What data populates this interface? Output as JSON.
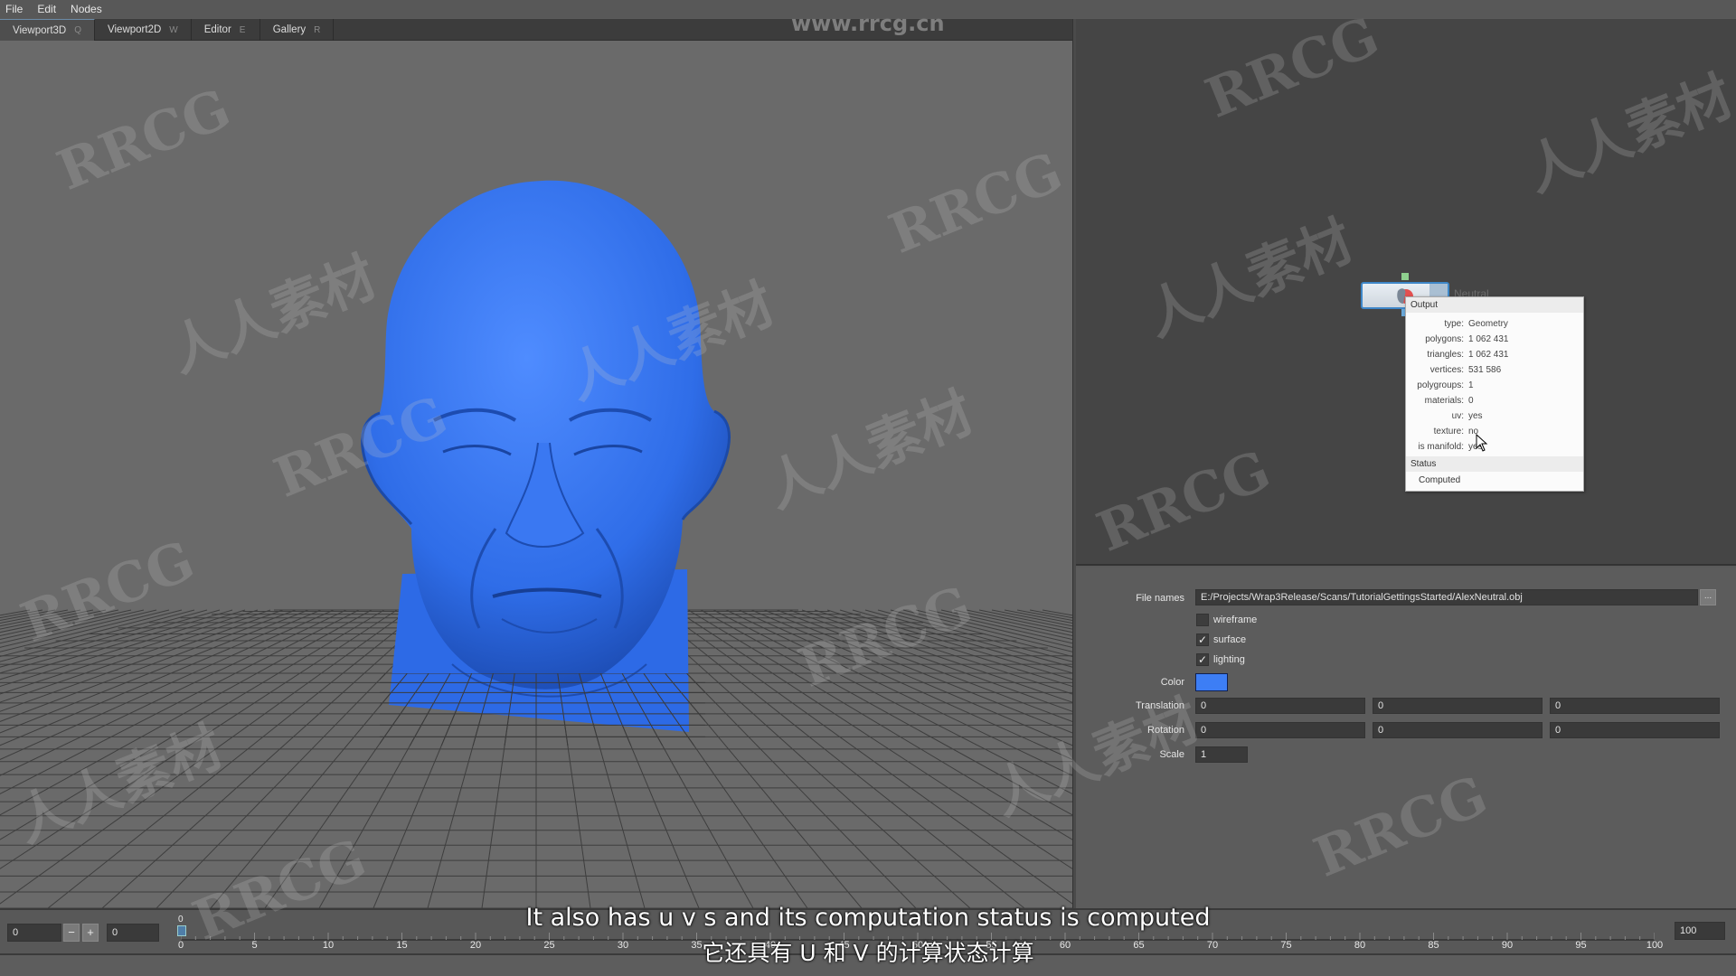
{
  "menubar": {
    "items": [
      "File",
      "Edit",
      "Nodes"
    ]
  },
  "tabs": [
    {
      "label": "Viewport3D",
      "key": "Q",
      "active": true
    },
    {
      "label": "Viewport2D",
      "key": "W",
      "active": false
    },
    {
      "label": "Editor",
      "key": "E",
      "active": false
    },
    {
      "label": "Gallery",
      "key": "R",
      "active": false
    }
  ],
  "watermark": {
    "url": "www.rrcg.cn",
    "brand": "RRCG",
    "cn": "人人素材"
  },
  "node": {
    "label": "Neutral",
    "popup": {
      "output_header": "Output",
      "rows": [
        {
          "key": "type:",
          "value": "Geometry"
        },
        {
          "key": "polygons:",
          "value": "1 062 431"
        },
        {
          "key": "triangles:",
          "value": "1 062 431"
        },
        {
          "key": "vertices:",
          "value": "531 586"
        },
        {
          "key": "polygroups:",
          "value": "1"
        },
        {
          "key": "materials:",
          "value": "0"
        },
        {
          "key": "uv:",
          "value": "yes"
        },
        {
          "key": "texture:",
          "value": "no"
        },
        {
          "key": "is manifold:",
          "value": "yes"
        }
      ],
      "status_header": "Status",
      "status_value": "Computed"
    }
  },
  "properties": {
    "file_names_label": "File names",
    "file_names_value": "E:/Projects/Wrap3Release/Scans/TutorialGettingsStarted/AlexNeutral.obj",
    "browse_label": "...",
    "wireframe": {
      "label": "wireframe",
      "checked": false
    },
    "surface": {
      "label": "surface",
      "checked": true
    },
    "lighting": {
      "label": "lighting",
      "checked": true
    },
    "color_label": "Color",
    "color_value": "#3d7ef5",
    "translation_label": "Translation",
    "translation": [
      "0",
      "0",
      "0"
    ],
    "rotation_label": "Rotation",
    "rotation": [
      "0",
      "0",
      "0"
    ],
    "scale_label": "Scale",
    "scale": "1"
  },
  "timeline": {
    "start": "0",
    "minus": "−",
    "plus": "+",
    "current": "0",
    "cursor_label": "0",
    "end": "100",
    "ticks": [
      "0",
      "5",
      "10",
      "15",
      "20",
      "25",
      "30",
      "35",
      "40",
      "45",
      "50",
      "55",
      "60",
      "65",
      "70",
      "75",
      "80",
      "85",
      "90",
      "95",
      "100"
    ]
  },
  "subtitles": {
    "en": "It also has u v s and its computation status is computed",
    "zh": "它还具有 U 和 V 的计算状态计算"
  }
}
